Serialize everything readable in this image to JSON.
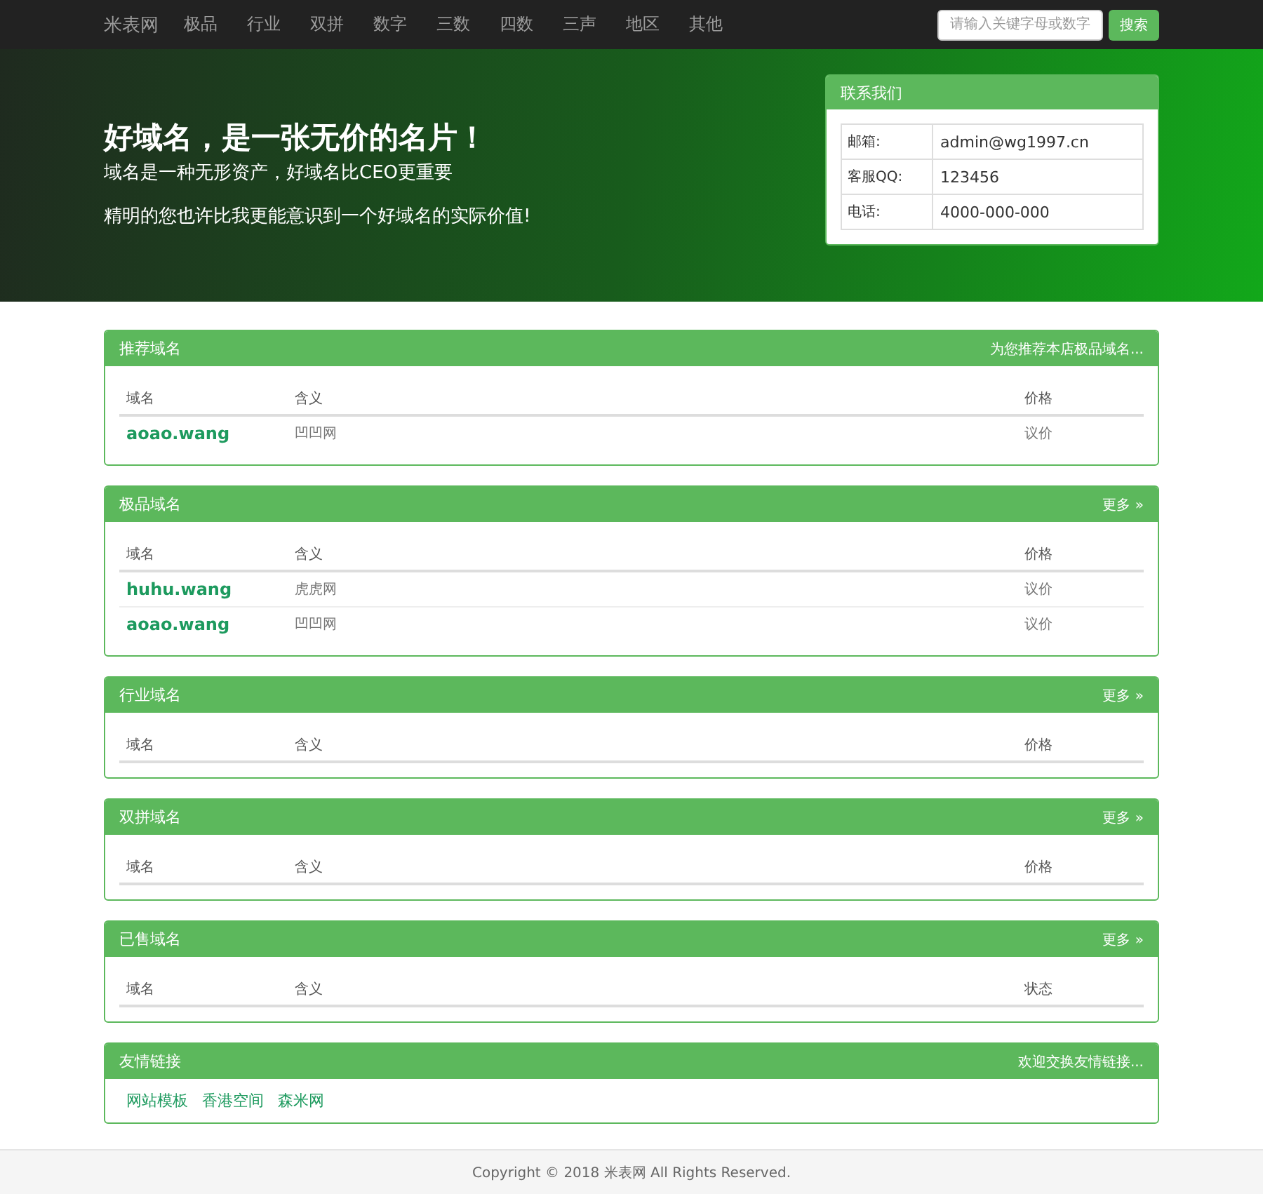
{
  "navbar": {
    "brand": "米表网",
    "items": [
      "极品",
      "行业",
      "双拼",
      "数字",
      "三数",
      "四数",
      "三声",
      "地区",
      "其他"
    ],
    "search": {
      "placeholder": "请输入关键字母或数字"
    },
    "search_button": "搜索"
  },
  "hero": {
    "title": "好域名，是一张无价的名片！",
    "subtitle": "域名是一种无形资产，好域名比CEO更重要",
    "tagline": "精明的您也许比我更能意识到一个好域名的实际价值!"
  },
  "contact": {
    "title": "联系我们",
    "rows": [
      {
        "label": "邮箱:",
        "value": "admin@wg1997.cn"
      },
      {
        "label": "客服QQ:",
        "value": "123456"
      },
      {
        "label": "电话:",
        "value": "4000-000-000"
      }
    ]
  },
  "panels": [
    {
      "title": "推荐域名",
      "extra": "为您推荐本店极品域名...",
      "columns": [
        "域名",
        "含义",
        "价格"
      ],
      "rows": [
        {
          "domain": "aoao.wang",
          "meaning": "凹凹网",
          "price": "议价"
        }
      ]
    },
    {
      "title": "极品域名",
      "extra": "更多 »",
      "columns": [
        "域名",
        "含义",
        "价格"
      ],
      "rows": [
        {
          "domain": "huhu.wang",
          "meaning": "虎虎网",
          "price": "议价"
        },
        {
          "domain": "aoao.wang",
          "meaning": "凹凹网",
          "price": "议价"
        }
      ]
    },
    {
      "title": "行业域名",
      "extra": "更多 »",
      "columns": [
        "域名",
        "含义",
        "价格"
      ]
    },
    {
      "title": "双拼域名",
      "extra": "更多 »",
      "columns": [
        "域名",
        "含义",
        "价格"
      ]
    },
    {
      "title": "已售域名",
      "extra": "更多 »",
      "columns": [
        "域名",
        "含义",
        "状态"
      ]
    }
  ],
  "links_panel": {
    "title": "友情链接",
    "extra": "欢迎交换友情链接...",
    "links": [
      "网站模板",
      "香港空间",
      "森米网"
    ]
  },
  "footer": "Copyright © 2018 米表网 All Rights Reserved."
}
